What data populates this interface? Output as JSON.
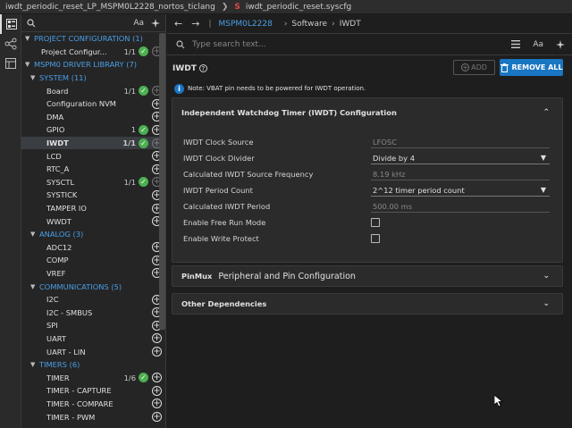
{
  "titlebar": {
    "project": "iwdt_periodic_reset_LP_MSPM0L2228_nortos_ticlang",
    "file_icon": "S",
    "file": "iwdt_periodic_reset.syscfg"
  },
  "sidebar": {
    "aa_label": "Aa",
    "tree": [
      {
        "kind": "cat",
        "label": "PROJECT CONFIGURATION (1)"
      },
      {
        "kind": "item top",
        "label": "Project Configur...",
        "count": "1/1",
        "checked": true,
        "plus_dim": true
      },
      {
        "kind": "cat",
        "label": "MSPM0 DRIVER LIBRARY (7)"
      },
      {
        "kind": "sub",
        "label": "SYSTEM (11)"
      },
      {
        "kind": "item",
        "label": "Board",
        "count": "1/1",
        "checked": true,
        "plus_dim": true
      },
      {
        "kind": "item",
        "label": "Configuration NVM"
      },
      {
        "kind": "item",
        "label": "DMA"
      },
      {
        "kind": "item",
        "label": "GPIO",
        "count": "1",
        "checked": true
      },
      {
        "kind": "item selected",
        "label": "IWDT",
        "count": "1/1",
        "checked": true,
        "plus_dim": true
      },
      {
        "kind": "item",
        "label": "LCD"
      },
      {
        "kind": "item",
        "label": "RTC_A"
      },
      {
        "kind": "item",
        "label": "SYSCTL",
        "count": "1/1",
        "checked": true,
        "plus_dim": true
      },
      {
        "kind": "item",
        "label": "SYSTICK"
      },
      {
        "kind": "item",
        "label": "TAMPER IO"
      },
      {
        "kind": "item",
        "label": "WWDT"
      },
      {
        "kind": "sub",
        "label": "ANALOG (3)"
      },
      {
        "kind": "item",
        "label": "ADC12"
      },
      {
        "kind": "item",
        "label": "COMP"
      },
      {
        "kind": "item",
        "label": "VREF"
      },
      {
        "kind": "sub",
        "label": "COMMUNICATIONS (5)"
      },
      {
        "kind": "item",
        "label": "I2C"
      },
      {
        "kind": "item",
        "label": "I2C - SMBUS"
      },
      {
        "kind": "item",
        "label": "SPI"
      },
      {
        "kind": "item",
        "label": "UART"
      },
      {
        "kind": "item",
        "label": "UART - LIN"
      },
      {
        "kind": "sub",
        "label": "TIMERS (6)"
      },
      {
        "kind": "item",
        "label": "TIMER",
        "count": "1/6",
        "checked": true
      },
      {
        "kind": "item",
        "label": "TIMER - CAPTURE"
      },
      {
        "kind": "item",
        "label": "TIMER - COMPARE"
      },
      {
        "kind": "item",
        "label": "TIMER - PWM"
      }
    ]
  },
  "navbar": {
    "device": "MSPM0L2228",
    "crumbs": [
      "Software",
      "IWDT"
    ]
  },
  "search": {
    "placeholder": "Type search text...",
    "aa_label": "Aa"
  },
  "module": {
    "title": "IWDT",
    "add_label": "ADD",
    "remove_label": "REMOVE ALL",
    "note": "Note: VBAT pin needs to be powered for IWDT operation."
  },
  "config_panel": {
    "title": "Independent Watchdog Timer (IWDT) Configuration",
    "fields": [
      {
        "label": "IWDT Clock Source",
        "value": "LFOSC",
        "type": "readonly"
      },
      {
        "label": "IWDT Clock Divider",
        "value": "Divide by 4",
        "type": "select"
      },
      {
        "label": "Calculated IWDT Source Frequency",
        "value": "8.19 kHz",
        "type": "readonly"
      },
      {
        "label": "IWDT Period Count",
        "value": "2^12 timer period count",
        "type": "select"
      },
      {
        "label": "Calculated IWDT Period",
        "value": "500.00 ms",
        "type": "readonly"
      },
      {
        "label": "Enable Free Run Mode",
        "type": "checkbox",
        "checked": false
      },
      {
        "label": "Enable Write Protect",
        "type": "checkbox",
        "checked": false
      }
    ]
  },
  "pinmux_panel": {
    "tag": "PinMux",
    "title": "Peripheral and Pin Configuration"
  },
  "deps_panel": {
    "title": "Other Dependencies"
  },
  "colors": {
    "accent_blue": "#1976c2",
    "link_blue": "#4a9fe6",
    "check_green": "#4caf50",
    "title_red": "#e04848"
  }
}
